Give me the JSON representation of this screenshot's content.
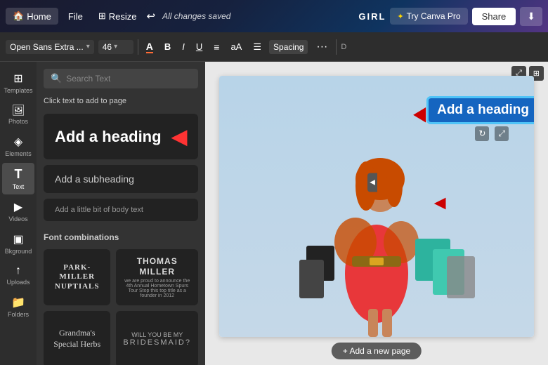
{
  "topbar": {
    "home_label": "Home",
    "file_label": "File",
    "resize_label": "Resize",
    "saved_label": "All changes saved",
    "project_name": "GIRL",
    "try_pro_label": "Try Canva Pro",
    "share_label": "Share",
    "download_icon": "⬇"
  },
  "text_toolbar": {
    "font_family": "Open Sans Extra ...",
    "font_size": "46",
    "bold_label": "B",
    "italic_label": "I",
    "underline_label": "U",
    "align_label": "≡",
    "case_label": "aA",
    "list_label": "☰",
    "spacing_label": "Spacing",
    "more_label": "···"
  },
  "sidebar": {
    "items": [
      {
        "id": "templates",
        "label": "Templates",
        "icon": "⊞"
      },
      {
        "id": "photos",
        "label": "Photos",
        "icon": "🖼"
      },
      {
        "id": "elements",
        "label": "Elements",
        "icon": "◈"
      },
      {
        "id": "text",
        "label": "Text",
        "icon": "T",
        "active": true
      },
      {
        "id": "videos",
        "label": "Videos",
        "icon": "▶"
      },
      {
        "id": "background",
        "label": "Bkground",
        "icon": "▣"
      },
      {
        "id": "uploads",
        "label": "Uploads",
        "icon": "↑"
      },
      {
        "id": "folders",
        "label": "Folders",
        "icon": "📁"
      }
    ]
  },
  "text_panel": {
    "search_placeholder": "Search Text",
    "click_instruction": "Click text to add to page",
    "add_heading_label": "Add a heading",
    "add_subheading_label": "Add a subheading",
    "add_body_label": "Add a little bit of body text",
    "font_combinations_label": "Font combinations",
    "font_combo_1_title": "PARK-MILLER\nNUPTIALS",
    "font_combo_1_sub": "",
    "font_combo_2_title": "THOMAS MILLER",
    "font_combo_2_sub": "we are proud to announce the 4th Annual Hometown Spurs Tour Stop this top title as a founder in 2012",
    "font_combo_3_title": "Grandma's\nSpecial Herbs"
  },
  "canvas": {
    "heading_text": "Add a heading",
    "add_page_label": "+ Add a new page"
  }
}
